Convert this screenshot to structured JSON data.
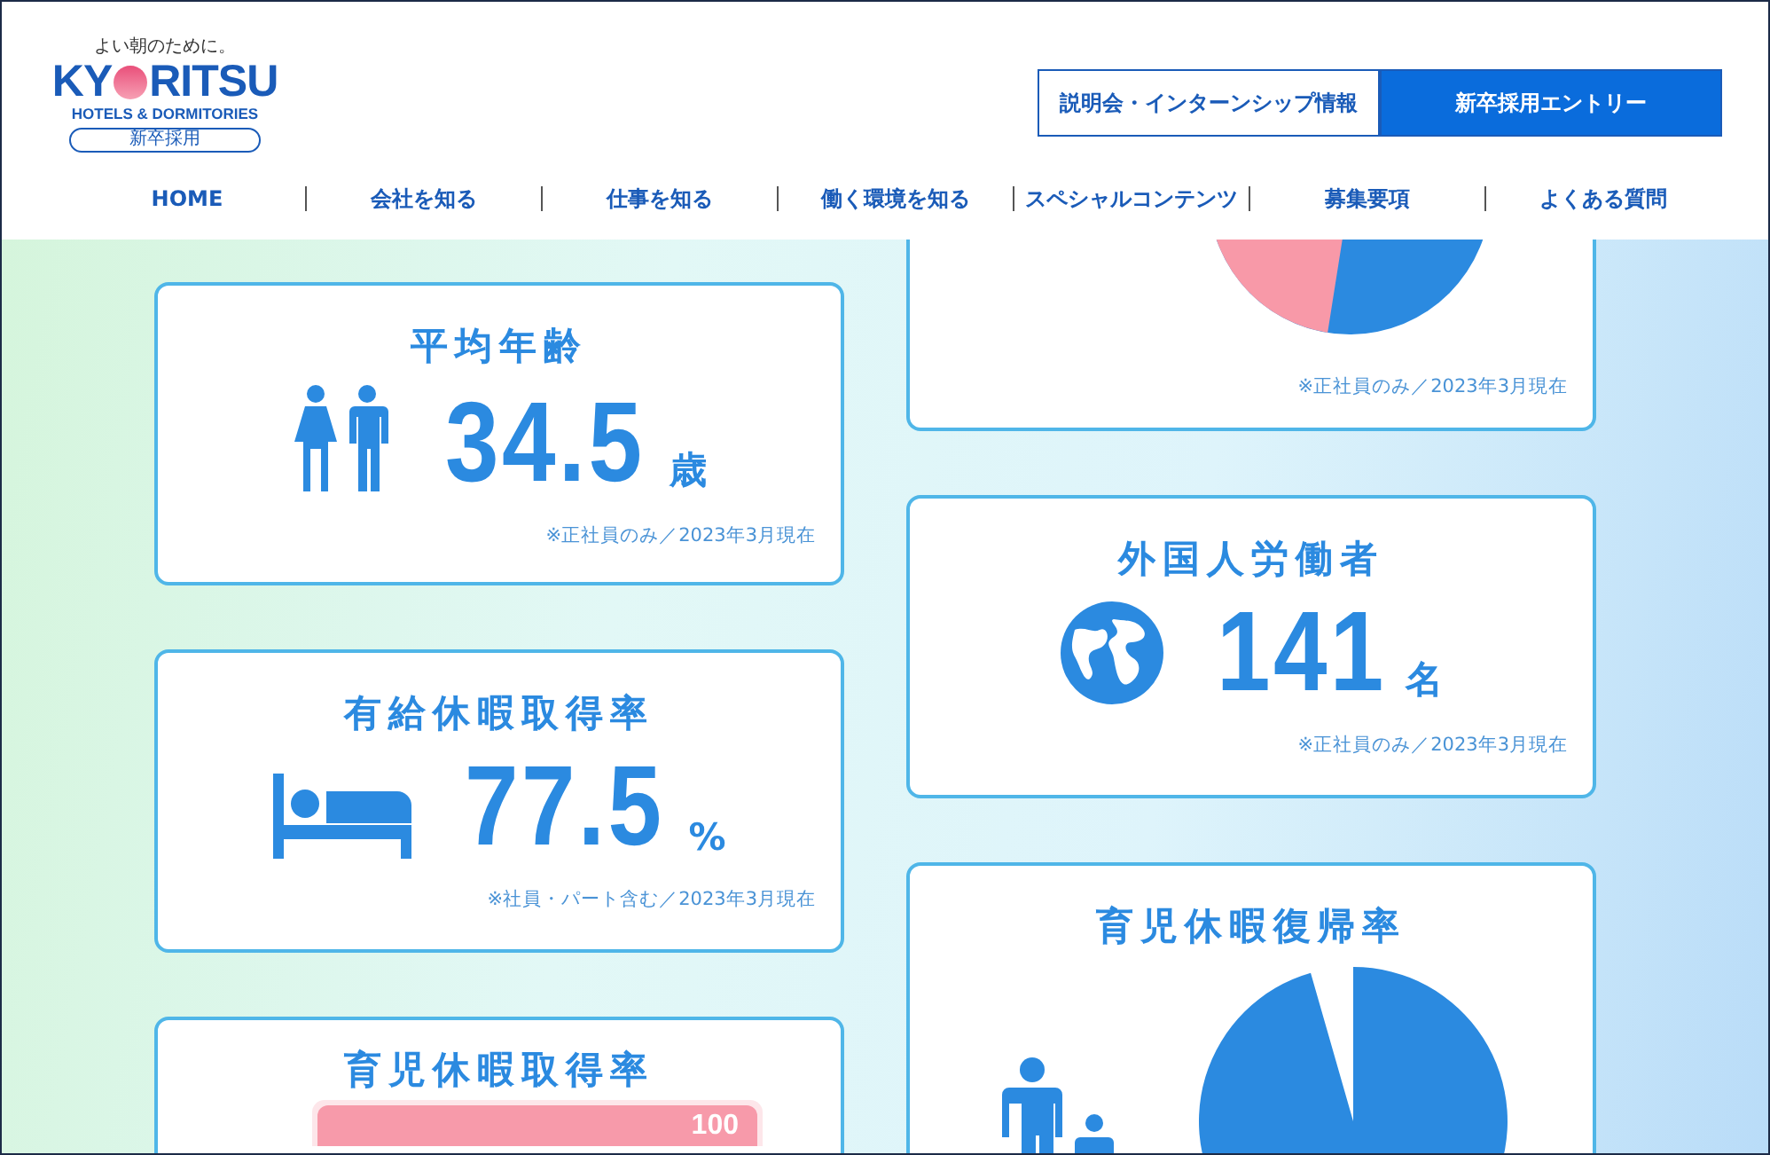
{
  "header": {
    "tagline": "よい朝のために。",
    "logo_before": "KY",
    "logo_after": "RITSU",
    "logo_sub": "HOTELS & DORMITORIES",
    "logo_badge": "新卒採用",
    "buttons": [
      {
        "label": "説明会・インターンシップ情報",
        "kind": "outline"
      },
      {
        "label": "新卒採用エントリー",
        "kind": "filled"
      }
    ]
  },
  "nav": [
    "HOME",
    "会社を知る",
    "仕事を知る",
    "働く環境を知る",
    "スペシャルコンテンツ",
    "募集要項",
    "よくある質問"
  ],
  "stats_left": [
    {
      "kind": "stat",
      "title": "平均年齢",
      "value": "34.5",
      "unit": "歳",
      "note": "※正社員のみ／2023年3月現在"
    },
    {
      "kind": "stat",
      "title": "有給休暇取得率",
      "value": "77.5",
      "unit": "%",
      "note": "※社員・パート含む／2023年3月現在"
    },
    {
      "kind": "bar",
      "title": "育児休暇取得率",
      "bar": {
        "label": "100",
        "level": 1
      }
    }
  ],
  "stats_right": [
    {
      "kind": "pie-tail",
      "note": "※正社員のみ／2023年3月現在"
    },
    {
      "kind": "stat",
      "title": "外国人労働者",
      "value": "141",
      "unit": "名",
      "note": "※正社員のみ／2023年3月現在"
    },
    {
      "kind": "pie",
      "title": "育児休暇復帰率"
    }
  ]
}
